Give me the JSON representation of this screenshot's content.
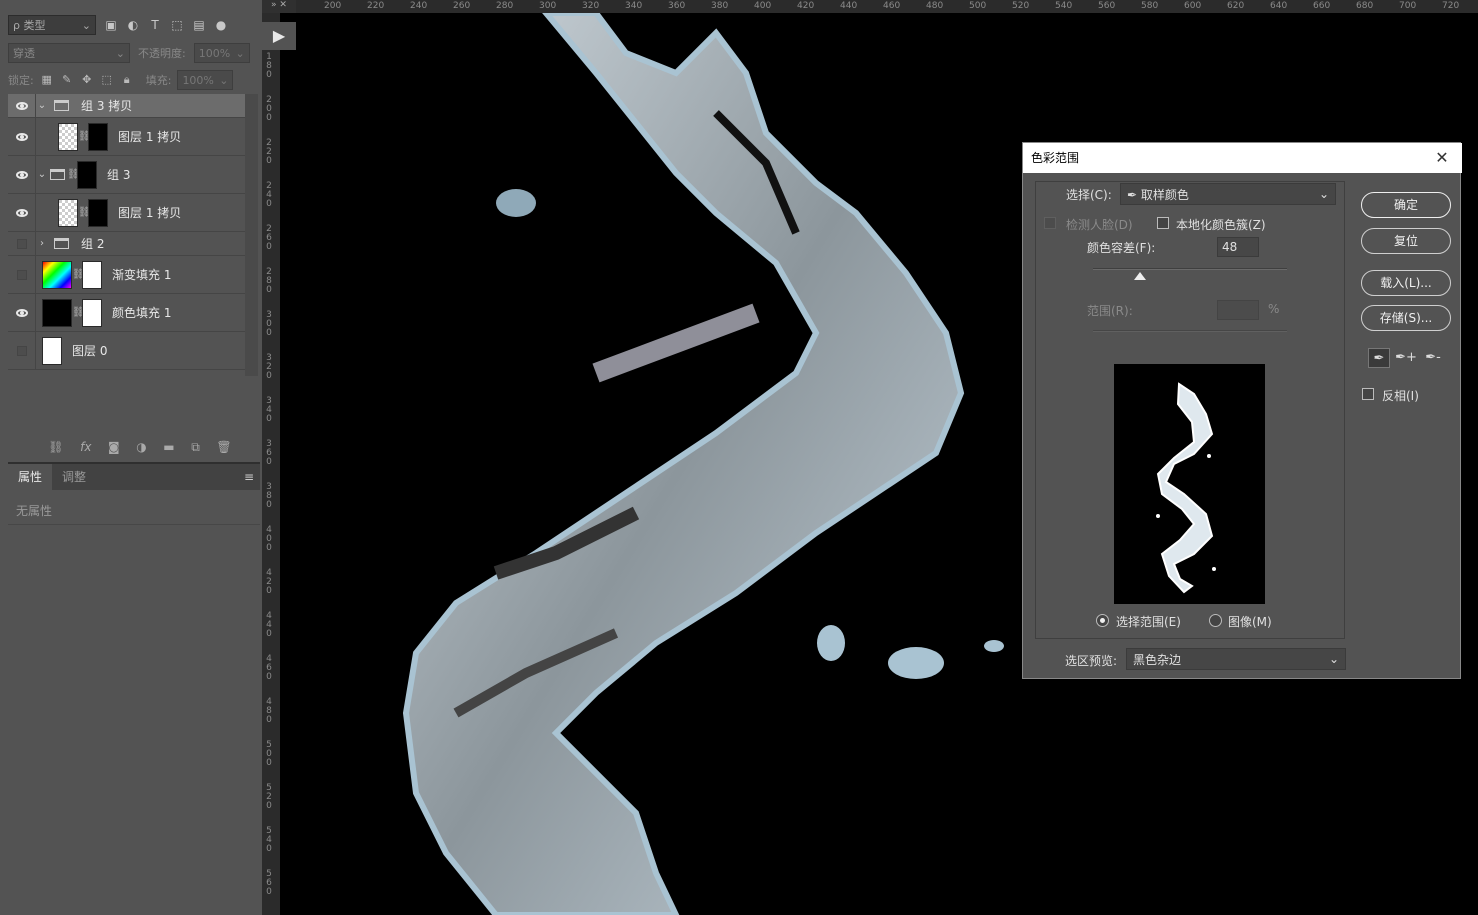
{
  "layers_panel": {
    "filter": {
      "kind_label": "ρ 类型"
    },
    "blend_mode": "穿透",
    "opacity": {
      "label": "不透明度:",
      "value": "100%"
    },
    "lock_label": "锁定:",
    "fill": {
      "label": "填充:",
      "value": "100%"
    },
    "layers": [
      {
        "name": "组 3 拷贝",
        "type": "group",
        "visible": true,
        "expanded": true,
        "selected": true
      },
      {
        "name": "图层 1 拷贝",
        "type": "layer-mask",
        "visible": true
      },
      {
        "name": "组 3",
        "type": "group-mask",
        "visible": true,
        "expanded": true
      },
      {
        "name": "图层 1 拷贝",
        "type": "layer-mask",
        "visible": true
      },
      {
        "name": "组 2",
        "type": "group",
        "visible": false,
        "expanded": false
      },
      {
        "name": "渐变填充 1",
        "type": "gradient-fill",
        "visible": false
      },
      {
        "name": "颜色填充 1",
        "type": "color-fill",
        "visible": true
      },
      {
        "name": "图层 0",
        "type": "layer",
        "visible": false
      }
    ],
    "bottom_icons": [
      "link-icon",
      "fx-icon",
      "mask-icon",
      "adjustment-icon",
      "folder-icon",
      "new-layer-icon",
      "trash-icon"
    ]
  },
  "properties_panel": {
    "tabs": [
      "属性",
      "调整"
    ],
    "empty_text": "无属性"
  },
  "rulers": {
    "horizontal": [
      "200",
      "220",
      "240",
      "260",
      "280",
      "300",
      "320",
      "340",
      "360",
      "380",
      "400",
      "420",
      "440",
      "460",
      "480",
      "500",
      "520",
      "540",
      "560",
      "580",
      "600",
      "620",
      "640",
      "660",
      "680",
      "700",
      "720"
    ],
    "vertical": [
      "180",
      "200",
      "220",
      "240",
      "260",
      "280",
      "300",
      "320",
      "340",
      "360",
      "380",
      "400",
      "420",
      "440",
      "460",
      "480",
      "500",
      "520",
      "540",
      "560"
    ]
  },
  "dialog": {
    "title": "色彩范围",
    "select_label": "选择(C):",
    "select_value": "取样颜色",
    "detect_faces": "检测人脸(D)",
    "localized_clusters": "本地化颜色簇(Z)",
    "fuzziness_label": "颜色容差(F):",
    "fuzziness_value": "48",
    "fuzziness_fraction": 0.24,
    "range_label": "范围(R):",
    "range_unit": "%",
    "radio_selection": "选择范围(E)",
    "radio_image": "图像(M)",
    "preview_label": "选区预览:",
    "preview_value": "黑色杂边",
    "ok": "确定",
    "reset": "复位",
    "load": "载入(L)...",
    "save": "存储(S)...",
    "invert": "反相(I)"
  },
  "colors": {
    "panel": "#535353",
    "canvas": "#000000",
    "water": "#a9c3d2"
  }
}
